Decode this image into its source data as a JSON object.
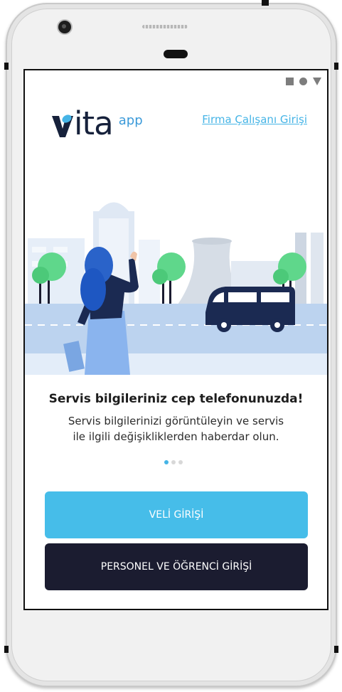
{
  "status_bar": {
    "icons": [
      "square-icon",
      "circle-icon",
      "triangle-icon"
    ]
  },
  "header": {
    "logo_text": "vita",
    "logo_suffix": "app",
    "employee_login_link": "Firma Çalışanı Girişi"
  },
  "onboarding": {
    "title": "Servis bilgileriniz cep telefonunuzda!",
    "description_line1": "Servis bilgilerinizi görüntüleyin ve servis",
    "description_line2": "ile ilgili değişikliklerden haberdar olun.",
    "page_index": 1,
    "page_count": 3
  },
  "actions": {
    "parent_login": "VELİ GİRİŞİ",
    "staff_student_login": "PERSONEL VE ÖĞRENCİ GİRİŞİ"
  },
  "colors": {
    "accent": "#46bde9",
    "dark_button": "#1b1c30",
    "logo_dark": "#16213b",
    "link": "#45b4e6"
  }
}
